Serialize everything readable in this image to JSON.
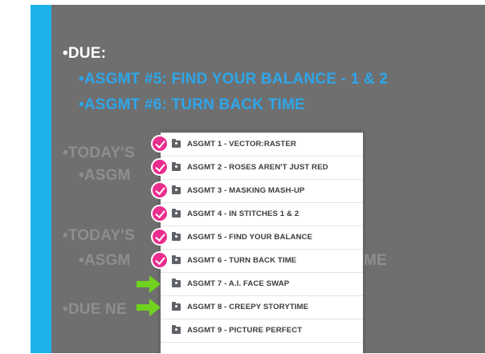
{
  "slide": {
    "due_heading": "•DUE:",
    "assignments_due": [
      "•ASGMT #5: FIND YOUR BALANCE - 1 & 2",
      "•ASGMT #6: TURN BACK TIME"
    ],
    "partially_hidden_text": [
      "•TODAY'S",
      "•ASGM",
      "•TODAY'S",
      "•ASGM",
      "ME",
      "•DUE NE"
    ],
    "colors": {
      "accent_bar": "#1eb2ea",
      "panel_bg": "#6f6f6f",
      "blue_text": "#2ea6ea",
      "check_badge": "#ea2e8d",
      "arrow": "#6fd31e"
    }
  },
  "folder_list": {
    "items": [
      {
        "label": "ASGMT 1 - VECTOR:RASTER",
        "icon": "shared-folder-icon",
        "marker": "check"
      },
      {
        "label": "ASGMT 2 - ROSES AREN'T JUST RED",
        "icon": "shared-folder-icon",
        "marker": "check"
      },
      {
        "label": "ASGMT 3 - MASKING MASH-UP",
        "icon": "shared-folder-icon",
        "marker": "check"
      },
      {
        "label": "ASGMT 4 - IN STITCHES 1 & 2",
        "icon": "shared-folder-icon",
        "marker": "check"
      },
      {
        "label": "ASGMT 5 - FIND YOUR BALANCE",
        "icon": "shared-folder-icon",
        "marker": "check"
      },
      {
        "label": "ASGMT 6 - TURN BACK TIME",
        "icon": "shared-folder-icon",
        "marker": "check"
      },
      {
        "label": "ASGMT 7 - A.I. FACE SWAP",
        "icon": "shared-folder-icon",
        "marker": "arrow"
      },
      {
        "label": "ASGMT 8 - CREEPY STORYTIME",
        "icon": "shared-folder-icon",
        "marker": "arrow"
      },
      {
        "label": "ASGMT 9 - PICTURE PERFECT",
        "icon": "shared-folder-icon",
        "marker": "none"
      }
    ]
  }
}
